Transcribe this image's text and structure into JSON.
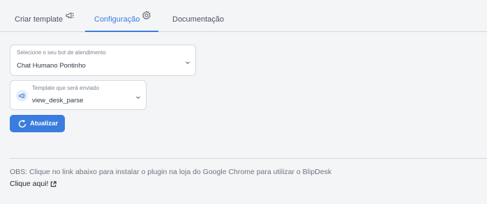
{
  "tabs": [
    {
      "label": "Criar template",
      "icon": "megaphone-icon"
    },
    {
      "label": "Configuração",
      "icon": "gear-icon",
      "active": true
    },
    {
      "label": "Documentação"
    }
  ],
  "bot_select": {
    "caption": "Selecione o seu bot de atendimento",
    "value": "Chat Humano Pontinho"
  },
  "template_select": {
    "caption": "Template que será enviado",
    "value": "view_desk_parse",
    "icon": "megaphone-icon"
  },
  "update_button": {
    "label": "Atualizar",
    "icon": "refresh-icon"
  },
  "footer": {
    "obs": "OBS: Clique no link abaixo para instalar o plugin na loja do Google Chrome para utilizar o BlipDesk",
    "link_label": "Clique aqui!",
    "link_icon": "external-link-icon"
  },
  "colors": {
    "accent": "#3b7ddd",
    "background": "#f4f5f7"
  }
}
